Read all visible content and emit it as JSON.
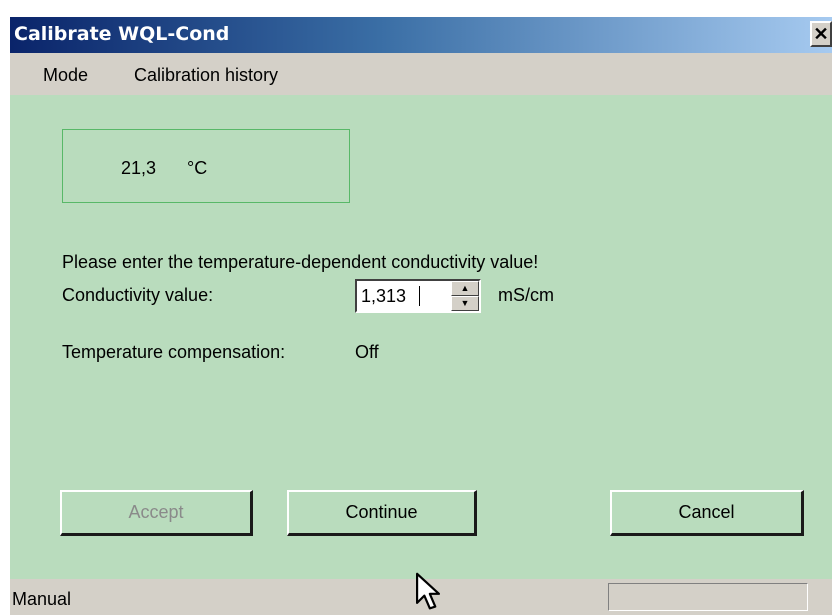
{
  "window": {
    "title": "Calibrate WQL-Cond",
    "close_glyph": "✕"
  },
  "menu": {
    "items": [
      {
        "label": "Mode"
      },
      {
        "label": "Calibration history"
      }
    ]
  },
  "temperature": {
    "value": "21,3",
    "unit": "°C"
  },
  "instruction": "Please enter the temperature-dependent conductivity value!",
  "conductivity": {
    "label": "Conductivity value:",
    "value": "1,313",
    "unit": "mS/cm"
  },
  "compensation": {
    "label": "Temperature compensation:",
    "value": "Off"
  },
  "buttons": {
    "accept": "Accept",
    "continue": "Continue",
    "cancel": "Cancel"
  },
  "status": {
    "text": "Manual"
  },
  "colors": {
    "client_bg": "#b9dcbd",
    "title_start": "#0a246a",
    "title_end": "#a6caf0"
  }
}
